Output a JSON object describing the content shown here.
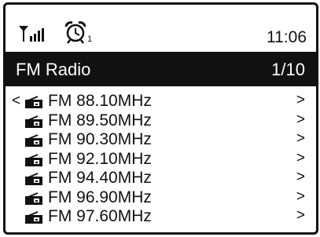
{
  "status": {
    "signal_icon": "signal-strength-icon",
    "alarm_icon": "alarm-clock-icon",
    "alarm_number": "1",
    "time": "11:06"
  },
  "header": {
    "title": "FM Radio",
    "page": "1/10"
  },
  "list": {
    "back_symbol": "<",
    "arrow_symbol": ">",
    "item_icon": "radio-icon",
    "items": [
      {
        "label": "FM 88.10MHz"
      },
      {
        "label": "FM 89.50MHz"
      },
      {
        "label": "FM 90.30MHz"
      },
      {
        "label": "FM 92.10MHz"
      },
      {
        "label": "FM 94.40MHz"
      },
      {
        "label": "FM 96.90MHz"
      },
      {
        "label": "FM 97.60MHz"
      }
    ]
  }
}
